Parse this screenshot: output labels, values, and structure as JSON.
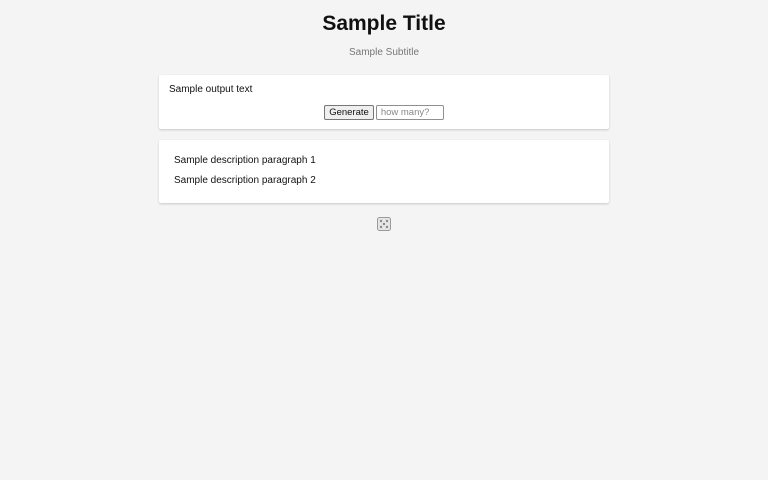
{
  "header": {
    "title": "Sample Title",
    "subtitle": "Sample Subtitle"
  },
  "output": {
    "text": "Sample output text",
    "generate_label": "Generate",
    "count_input": {
      "value": "",
      "placeholder": "how many?"
    }
  },
  "description": {
    "paragraphs": [
      "Sample description paragraph 1",
      "Sample description paragraph 2"
    ]
  },
  "footer": {
    "icon": "dice-icon"
  }
}
